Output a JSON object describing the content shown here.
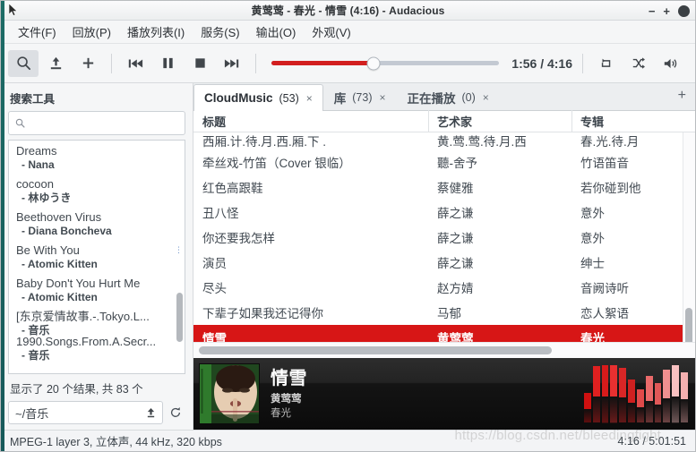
{
  "window": {
    "title": "黄莺莺 - 春光 - 情雪 (4:16) - Audacious",
    "minimize_label": "−",
    "maximize_label": "+",
    "close_label": "✕"
  },
  "menubar": {
    "items": [
      {
        "label": "文件(F)",
        "name": "menu-file"
      },
      {
        "label": "回放(P)",
        "name": "menu-playback"
      },
      {
        "label": "播放列表(I)",
        "name": "menu-playlist"
      },
      {
        "label": "服务(S)",
        "name": "menu-services"
      },
      {
        "label": "输出(O)",
        "name": "menu-output"
      },
      {
        "label": "外观(V)",
        "name": "menu-view"
      }
    ]
  },
  "toolbar": {
    "search_icon": "search-icon",
    "open_icon": "open-folder-icon",
    "add_icon": "add-icon",
    "prev_icon": "previous-track-icon",
    "pause_icon": "pause-icon",
    "stop_icon": "stop-icon",
    "next_icon": "next-track-icon",
    "repeat_icon": "repeat-icon",
    "shuffle_icon": "shuffle-icon",
    "volume_icon": "volume-icon",
    "time_display": "1:56 / 4:16",
    "seek_percent": 45,
    "accent_color": "#d21f1f"
  },
  "search_tool": {
    "title": "搜索工具",
    "search_placeholder": "",
    "search_value": "",
    "results": [
      {
        "title": "1990.Songs.From.A.Secr...",
        "sub": "- 音乐",
        "clipped": true
      },
      {
        "title": "[东京爱情故事.-.Tokyo.L...",
        "sub": "- 音乐",
        "clipped": false
      },
      {
        "title": "Baby Don't You Hurt Me",
        "sub": "- Atomic Kitten",
        "clipped": false
      },
      {
        "title": "Be With You",
        "sub": "- Atomic Kitten",
        "clipped": false
      },
      {
        "title": "Beethoven Virus",
        "sub": "- Diana Boncheva",
        "clipped": false
      },
      {
        "title": "cocoon",
        "sub": "- 林ゆうき",
        "clipped": false
      },
      {
        "title": "Dreams",
        "sub": "- Nana",
        "clipped": false
      }
    ],
    "count_text": "显示了 20 个结果, 共 83 个",
    "path_value": "~/音乐",
    "path_up_icon": "up-arrow-icon",
    "refresh_icon": "refresh-icon"
  },
  "tabs": [
    {
      "name": "CloudMusic",
      "count": "(53)",
      "close": "×",
      "active": true
    },
    {
      "name": "库",
      "count": "(73)",
      "close": "×",
      "active": false
    },
    {
      "name": "正在播放",
      "count": "(0)",
      "close": "×",
      "active": false
    }
  ],
  "tab_add_label": "+",
  "playlist": {
    "columns": [
      "标题",
      "艺术家",
      "专辑"
    ],
    "rows": [
      {
        "title": "西厢.计.待.月.西.厢.下 .",
        "artist": "黄.莺.莺.待.月.西",
        "album": "春.光.待.月",
        "clipped": true,
        "selected": false
      },
      {
        "title": "牵丝戏-竹笛（Cover 银临）",
        "artist": "聽-舍予",
        "album": "竹语笛音",
        "clipped": false,
        "selected": false
      },
      {
        "title": "红色高跟鞋",
        "artist": "蔡健雅",
        "album": "若你碰到他",
        "clipped": false,
        "selected": false
      },
      {
        "title": "丑八怪",
        "artist": "薛之谦",
        "album": "意外",
        "clipped": false,
        "selected": false
      },
      {
        "title": "你还要我怎样",
        "artist": "薛之谦",
        "album": "意外",
        "clipped": false,
        "selected": false
      },
      {
        "title": "演员",
        "artist": "薛之谦",
        "album": "绅士",
        "clipped": false,
        "selected": false
      },
      {
        "title": "尽头",
        "artist": "赵方婧",
        "album": "音阙诗听",
        "clipped": false,
        "selected": false
      },
      {
        "title": "下辈子如果我还记得你",
        "artist": "马郁",
        "album": "恋人絮语",
        "clipped": false,
        "selected": false
      },
      {
        "title": "情雪",
        "artist": "黄莺莺",
        "album": "春光",
        "clipped": false,
        "selected": true
      }
    ],
    "selection_color": "#d71616"
  },
  "now_playing": {
    "title": "情雪",
    "artist": "黄莺莺",
    "album": "春光",
    "album_art": "album-cover-art",
    "visualizer": {
      "name": "spectrum-visualizer",
      "bars": [
        18,
        34,
        40,
        52,
        33,
        26,
        20,
        28,
        24,
        32,
        44,
        30
      ]
    }
  },
  "statusbar": {
    "format_text": "MPEG-1 layer 3, 立体声, 44 kHz, 320 kbps",
    "time_text": "4:16 / 5:01:51"
  },
  "watermark": "https://blog.csdn.net/bleedingfight"
}
